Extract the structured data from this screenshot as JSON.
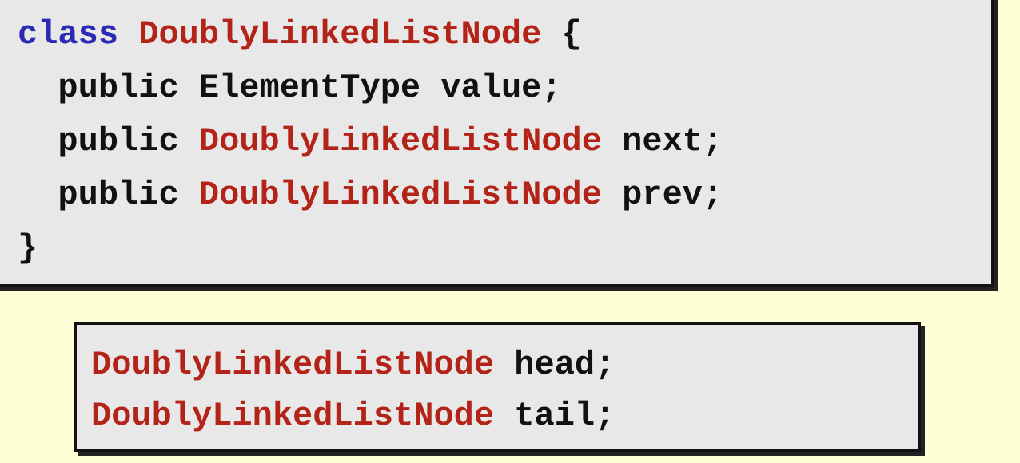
{
  "class_block": {
    "line1": {
      "keyword": "class",
      "type": "DoublyLinkedListNode",
      "rest": " {"
    },
    "line2": {
      "indent": "  ",
      "modifier": "public",
      "type": "ElementType",
      "rest": " value;"
    },
    "line3": {
      "indent": "  ",
      "modifier": "public",
      "type": "DoublyLinkedListNode",
      "rest": " next;"
    },
    "line4": {
      "indent": "  ",
      "modifier": "public",
      "type": "DoublyLinkedListNode",
      "rest": " prev;"
    },
    "line5": {
      "text": "}"
    }
  },
  "var_block": {
    "line1": {
      "type": "DoublyLinkedListNode",
      "rest": " head;"
    },
    "line2": {
      "type": "DoublyLinkedListNode",
      "rest": " tail;"
    }
  },
  "colors": {
    "background": "#ffffd7",
    "box": "#e8e8e8",
    "keyword_blue": "#2a2ab4",
    "type_red": "#b42318",
    "text": "#111111"
  }
}
